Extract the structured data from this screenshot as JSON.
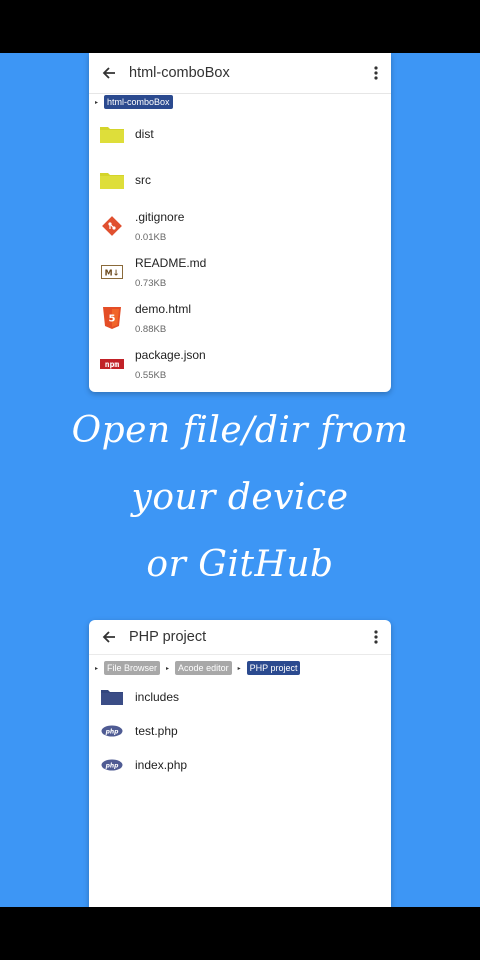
{
  "card1": {
    "title": "html-comboBox",
    "breadcrumbs": [
      "html-comboBox"
    ],
    "items": [
      {
        "name": "dist",
        "size": "",
        "icon": "folder-icon"
      },
      {
        "name": "src",
        "size": "",
        "icon": "folder-icon"
      },
      {
        "name": ".gitignore",
        "size": "0.01KB",
        "icon": "git-icon"
      },
      {
        "name": "README.md",
        "size": "0.73KB",
        "icon": "markdown-icon"
      },
      {
        "name": "demo.html",
        "size": "0.88KB",
        "icon": "html5-icon"
      },
      {
        "name": "package.json",
        "size": "0.55KB",
        "icon": "npm-icon"
      }
    ]
  },
  "headline": {
    "line1": "Open file/dir from",
    "line2": "your device",
    "line3": "or GitHub"
  },
  "card2": {
    "title": "PHP project",
    "breadcrumbs": [
      "File Browser",
      "Acode editor",
      "PHP project"
    ],
    "items": [
      {
        "name": "includes",
        "icon": "folder-icon"
      },
      {
        "name": "test.php",
        "icon": "php-icon"
      },
      {
        "name": "index.php",
        "icon": "php-icon"
      }
    ]
  },
  "colors": {
    "background": "#3d96f5",
    "folder_yellow": "#d4d42a",
    "folder_dark": "#3b4d86",
    "crumb_active": "#2b4a8f"
  }
}
